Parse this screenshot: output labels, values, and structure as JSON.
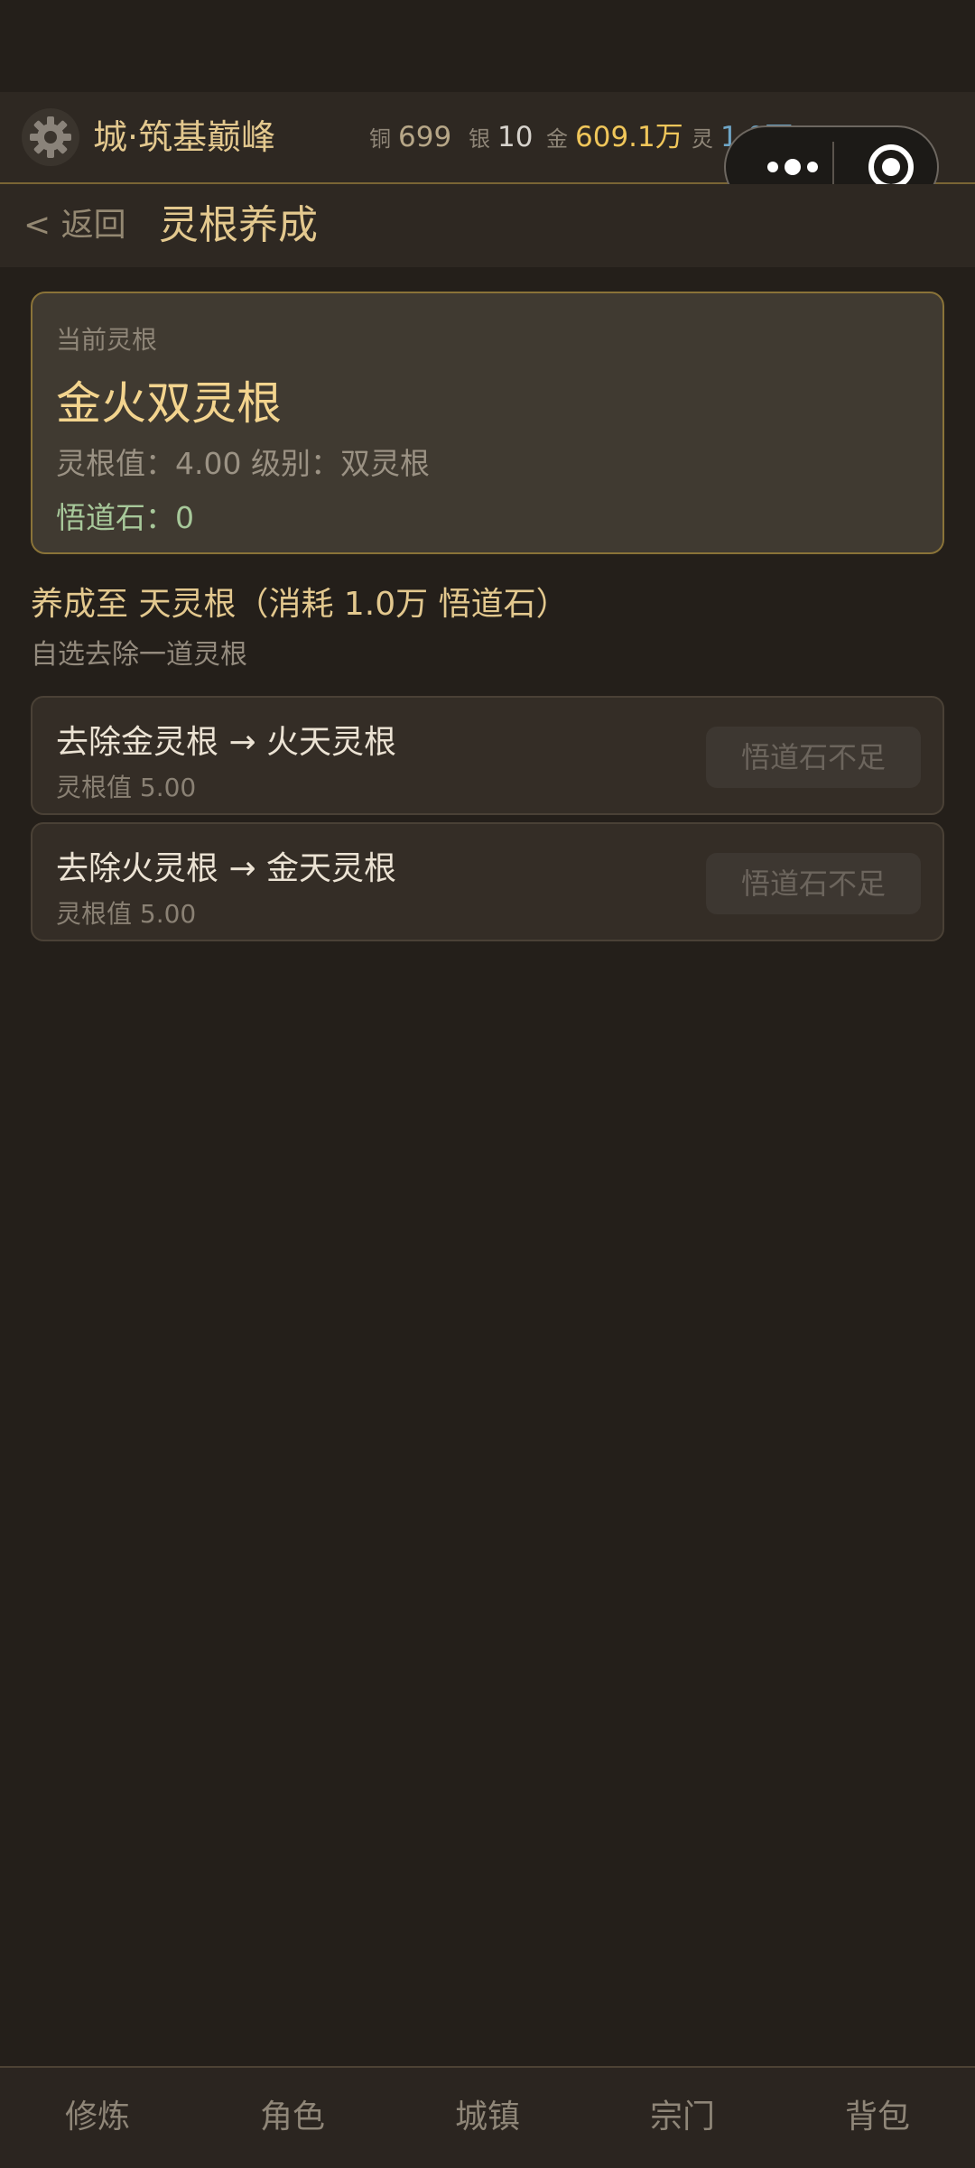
{
  "header": {
    "location": "城·筑基巅峰",
    "currencies": [
      {
        "label": "铜",
        "value": "699",
        "color": "#b6a687"
      },
      {
        "label": "银",
        "value": "10",
        "color": "#d6d2cc"
      },
      {
        "label": "金",
        "value": "609.1万",
        "color": "#f0c65a"
      },
      {
        "label": "灵",
        "value": "1.0万",
        "color": "#6fa6c7"
      }
    ]
  },
  "nav": {
    "back_label": "< 返回",
    "title": "灵根养成"
  },
  "current": {
    "label": "当前灵根",
    "name": "金火双灵根",
    "stats": "灵根值：4.00  级别：双灵根",
    "stone": "悟道石：0"
  },
  "cultivate": {
    "title": "养成至 天灵根（消耗 1.0万 悟道石）",
    "subtitle": "自选去除一道灵根",
    "options": [
      {
        "title": "去除金灵根 → 火天灵根",
        "value": "灵根值 5.00",
        "button": "悟道石不足"
      },
      {
        "title": "去除火灵根 → 金天灵根",
        "value": "灵根值 5.00",
        "button": "悟道石不足"
      }
    ]
  },
  "tabs": [
    "修炼",
    "角色",
    "城镇",
    "宗门",
    "背包"
  ],
  "icons": {
    "settings": "gear-icon",
    "more": "more-dots-icon",
    "close": "target-circle-icon"
  }
}
